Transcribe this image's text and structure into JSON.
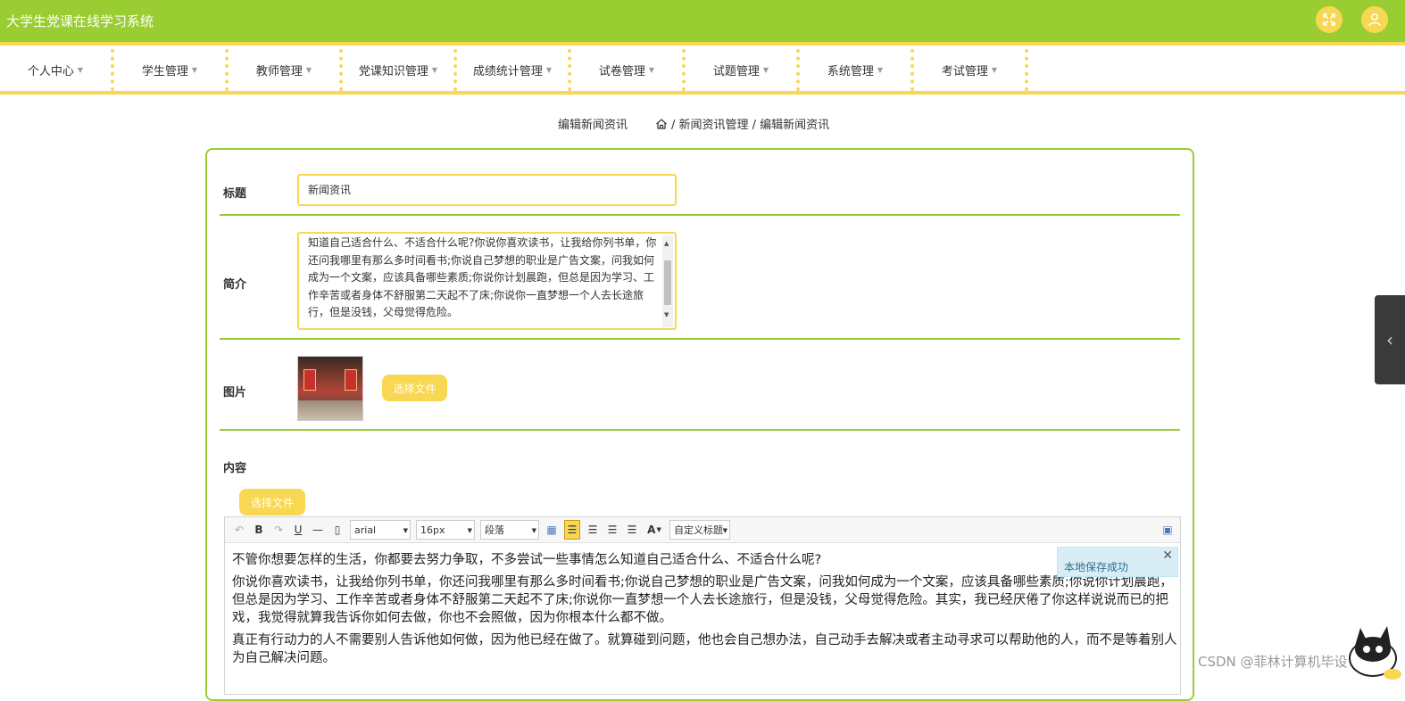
{
  "app": {
    "title": "大学生党课在线学习系统"
  },
  "header_icons": [
    "fullscreen-icon",
    "user-icon"
  ],
  "nav": {
    "items": [
      {
        "label": "个人中心"
      },
      {
        "label": "学生管理"
      },
      {
        "label": "教师管理"
      },
      {
        "label": "党课知识管理"
      },
      {
        "label": "成绩统计管理"
      },
      {
        "label": "试卷管理"
      },
      {
        "label": "试题管理"
      },
      {
        "label": "系统管理"
      },
      {
        "label": "考试管理"
      }
    ]
  },
  "breadcrumb": {
    "page_title": "编辑新闻资讯",
    "path": "/ 新闻资讯管理 / 编辑新闻资讯"
  },
  "form": {
    "title_label": "标题",
    "title_value": "新闻资讯",
    "intro_label": "简介",
    "intro_value": "知道自己适合什么、不适合什么呢?你说你喜欢读书，让我给你列书单，你还问我哪里有那么多时间看书;你说自己梦想的职业是广告文案，问我如何成为一个文案，应该具备哪些素质;你说你计划晨跑，但总是因为学习、工作辛苦或者身体不舒服第二天起不了床;你说你一直梦想一个人去长途旅行，但是没钱，父母觉得危险。",
    "image_label": "图片",
    "image_button": "选择文件",
    "content_label": "内容",
    "content_button": "选择文件"
  },
  "editor": {
    "font_family": "arial",
    "font_size": "16px",
    "paragraph": "段落",
    "custom_heading": "自定义标题",
    "toast": "本地保存成功",
    "paragraphs": [
      "不管你想要怎样的生活，你都要去努力争取，不多尝试一些事情怎么知道自己适合什么、不适合什么呢?",
      "你说你喜欢读书，让我给你列书单，你还问我哪里有那么多时间看书;你说自己梦想的职业是广告文案，问我如何成为一个文案，应该具备哪些素质;你说你计划晨跑，但总是因为学习、工作辛苦或者身体不舒服第二天起不了床;你说你一直梦想一个人去长途旅行，但是没钱，父母觉得危险。其实，我已经厌倦了你这样说说而已的把戏，我觉得就算我告诉你如何去做，你也不会照做，因为你根本什么都不做。",
      "真正有行动力的人不需要别人告诉他如何做，因为他已经在做了。就算碰到问题，他也会自己想办法，自己动手去解决或者主动寻求可以帮助他的人，而不是等着别人为自己解决问题。"
    ]
  },
  "watermark": "CSDN @菲林计算机毕设"
}
